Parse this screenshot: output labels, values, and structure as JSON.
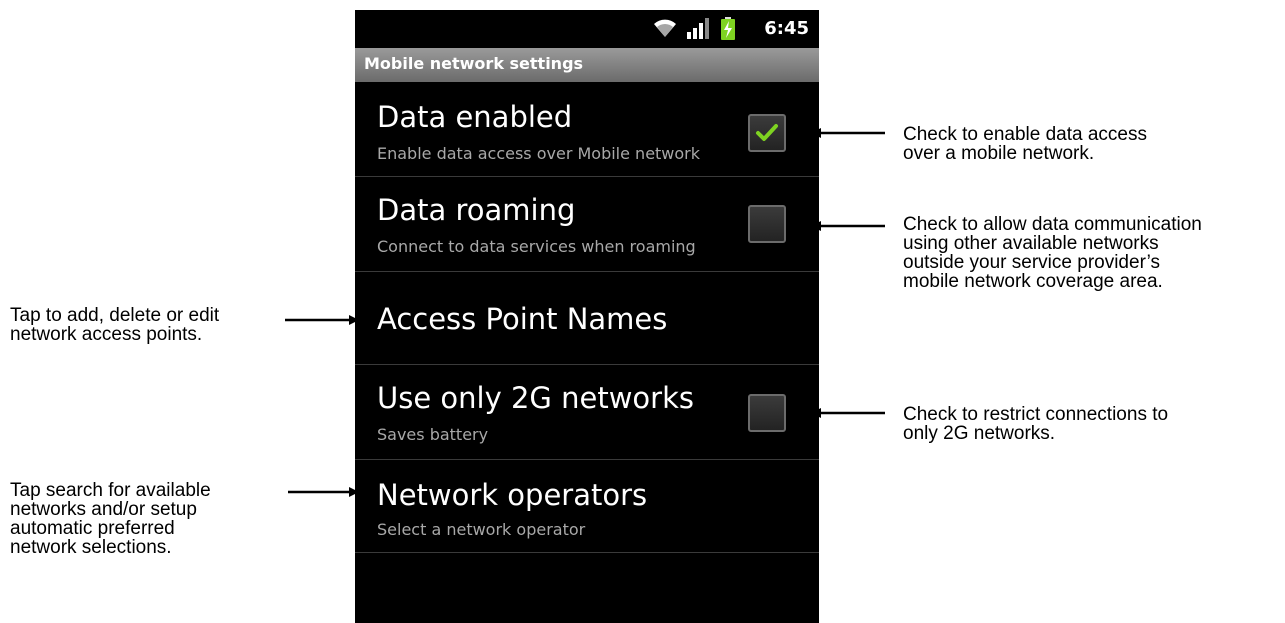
{
  "statusbar": {
    "time": "6:45",
    "icons": [
      "wifi-icon",
      "signal-bars-icon",
      "battery-charging-icon"
    ],
    "battery_color": "#7ed321"
  },
  "titlebar": {
    "title": "Mobile network settings"
  },
  "settings": [
    {
      "title": "Data enabled",
      "summary": "Enable data access over Mobile network",
      "checked": true
    },
    {
      "title": "Data roaming",
      "summary": "Connect to data services when roaming",
      "checked": false
    },
    {
      "title": "Access Point Names"
    },
    {
      "title": "Use only 2G networks",
      "summary": "Saves battery",
      "checked": false
    },
    {
      "title": "Network operators",
      "summary": "Select a network operator"
    }
  ],
  "annotations": {
    "data_enabled": "Check to enable data access\nover a mobile network.",
    "data_roaming": "Check to allow data communication\nusing other available networks\noutside your service provider’s\nmobile network coverage area.",
    "apn": "Tap to add, delete or edit\nnetwork access points.",
    "only_2g": "Check to restrict connections to\nonly 2G networks.",
    "operators": "Tap search for available\nnetworks and/or setup\nautomatic preferred\nnetwork selections."
  },
  "colors": {
    "checkmark": "#7ed321",
    "screen_bg": "#000000"
  }
}
